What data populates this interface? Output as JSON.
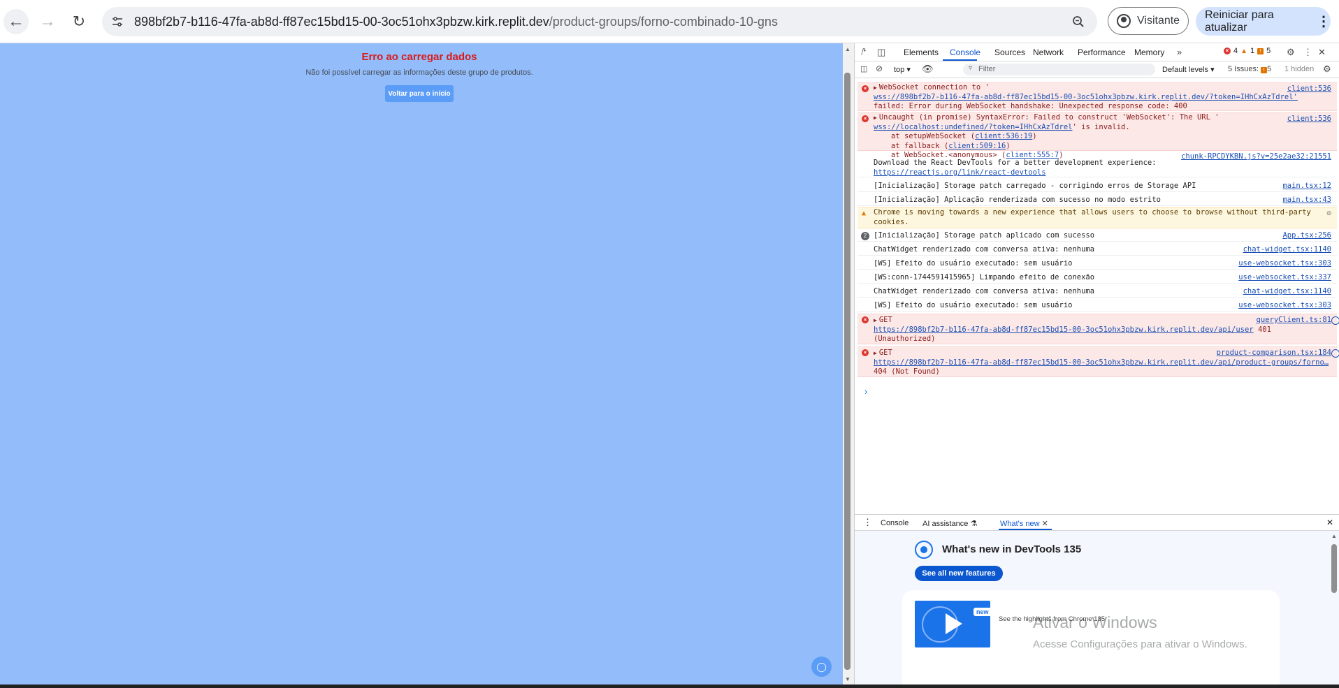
{
  "browser": {
    "url_host": "898bf2b7-b116-47fa-ab8d-ff87ec15bd15-00-3oc51ohx3pbzw.kirk.replit.dev",
    "url_path": "/product-groups/forno-combinado-10-gns",
    "profile_label": "Visitante",
    "update_label": "Reiniciar para atualizar"
  },
  "page": {
    "error_title": "Erro ao carregar dados",
    "error_message": "Não foi possível carregar as informações deste grupo de produtos.",
    "home_button": "Voltar para o início"
  },
  "devtools": {
    "tabs": [
      "Elements",
      "Console",
      "Sources",
      "Network",
      "Performance",
      "Memory"
    ],
    "errors_count": "4",
    "warnings_count": "1",
    "issues_count": "5",
    "context": "top",
    "filter_placeholder": "Filter",
    "levels": "Default levels",
    "issues_label": "5 Issues:",
    "issues_num": "5",
    "hidden_label": "1 hidden",
    "messages": [
      {
        "type": "error",
        "lines": [
          "WebSocket connection to '",
          "wss://898bf2b7-b116-47fa-ab8d-ff87ec15bd15-00-3oc51ohx3pbzw.kirk.replit.dev/?token=IHhCxAzTdrel'",
          "failed: Error during WebSocket handshake: Unexpected response code: 400"
        ],
        "source": "client:536"
      },
      {
        "type": "error",
        "lines": [
          "Uncaught (in promise) SyntaxError: Failed to construct 'WebSocket': The URL '",
          "wss://localhost:undefined/?token=IHhCxAzTdrel",
          "' is invalid.",
          "at setupWebSocket (",
          "client:536:19",
          ")",
          "at fallback (",
          "client:509:16",
          ")",
          "at WebSocket.<anonymous> (",
          "client:555:7",
          ")"
        ],
        "source": "client:536"
      },
      {
        "type": "info",
        "lines": [
          "Download the React DevTools for a better development experience:",
          "https://reactjs.org/link/react-devtools"
        ],
        "source": "chunk-RPCDYKBN.js?v=25e2ae32:21551"
      },
      {
        "type": "info",
        "text": "[Inicialização] Storage patch carregado - corrigindo erros de Storage API",
        "source": "main.tsx:12"
      },
      {
        "type": "info",
        "text": "[Inicialização] Aplicação renderizada com sucesso no modo estrito",
        "source": "main.tsx:43"
      },
      {
        "type": "warn",
        "lines": [
          "Chrome is moving towards a new experience that allows users to choose to browse without third-party",
          "cookies."
        ]
      },
      {
        "type": "info",
        "count": "2",
        "text": "[Inicialização] Storage patch aplicado com sucesso",
        "source": "App.tsx:256"
      },
      {
        "type": "info",
        "text": "ChatWidget renderizado com conversa ativa: nenhuma",
        "source": "chat-widget.tsx:1140"
      },
      {
        "type": "info",
        "text": "[WS] Efeito do usuário executado: sem usuário",
        "source": "use-websocket.tsx:303"
      },
      {
        "type": "info",
        "text": "[WS:conn-1744591415965] Limpando efeito de conexão",
        "source": "use-websocket.tsx:337"
      },
      {
        "type": "info",
        "text": "ChatWidget renderizado com conversa ativa: nenhuma",
        "source": "chat-widget.tsx:1140"
      },
      {
        "type": "info",
        "text": "[WS] Efeito do usuário executado: sem usuário",
        "source": "use-websocket.tsx:303"
      },
      {
        "type": "error",
        "lines": [
          "GET",
          "https://898bf2b7-b116-47fa-ab8d-ff87ec15bd15-00-3oc51ohx3pbzw.kirk.replit.dev/api/user",
          "401",
          "(Unauthorized)"
        ],
        "source": "queryClient.ts:81"
      },
      {
        "type": "error",
        "lines": [
          "GET",
          "https://898bf2b7-b116-47fa-ab8d-ff87ec15bd15-00-3oc51ohx3pbzw.kirk.replit.dev/api/product-groups/forno…",
          "404 (Not Found)"
        ],
        "source": "product-comparison.tsx:184"
      }
    ],
    "drawer_tabs": [
      "Console",
      "AI assistance",
      "What's new"
    ],
    "whats_new_title": "What's new in DevTools 135",
    "see_all_label": "See all new features",
    "video_badge": "new",
    "video_caption": "See the highlights from Chrome 135"
  },
  "os": {
    "watermark_title": "Ativar o Windows",
    "watermark_text": "Acesse Configurações para ativar o Windows."
  }
}
